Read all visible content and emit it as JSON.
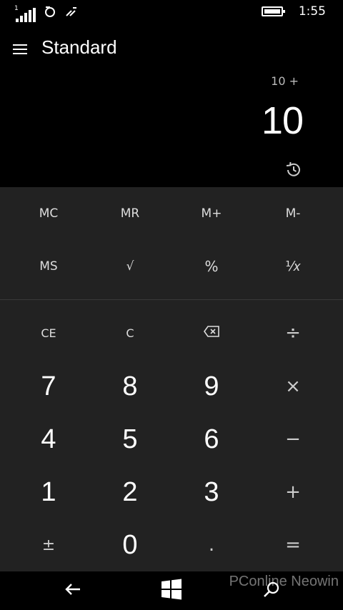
{
  "status": {
    "sim_number": "1",
    "time": "1:55"
  },
  "app": {
    "title": "Standard"
  },
  "display": {
    "expression": "10 +",
    "result": "10"
  },
  "keys": {
    "mc": "MC",
    "mr": "MR",
    "mplus": "M+",
    "mminus": "M-",
    "ms": "MS",
    "sqrt": "√",
    "percent": "%",
    "reciprocal": "¹⁄𝑥",
    "ce": "CE",
    "c": "C",
    "divide": "÷",
    "multiply": "×",
    "minus": "−",
    "plus": "+",
    "plusminus": "±",
    "decimal": ".",
    "equals": "=",
    "d0": "0",
    "d1": "1",
    "d2": "2",
    "d3": "3",
    "d4": "4",
    "d5": "5",
    "d6": "6",
    "d7": "7",
    "d8": "8",
    "d9": "9"
  },
  "watermark": "PConline Neowin",
  "colors": {
    "background": "#000000",
    "keypad": "#222222",
    "text": "#ffffff"
  }
}
